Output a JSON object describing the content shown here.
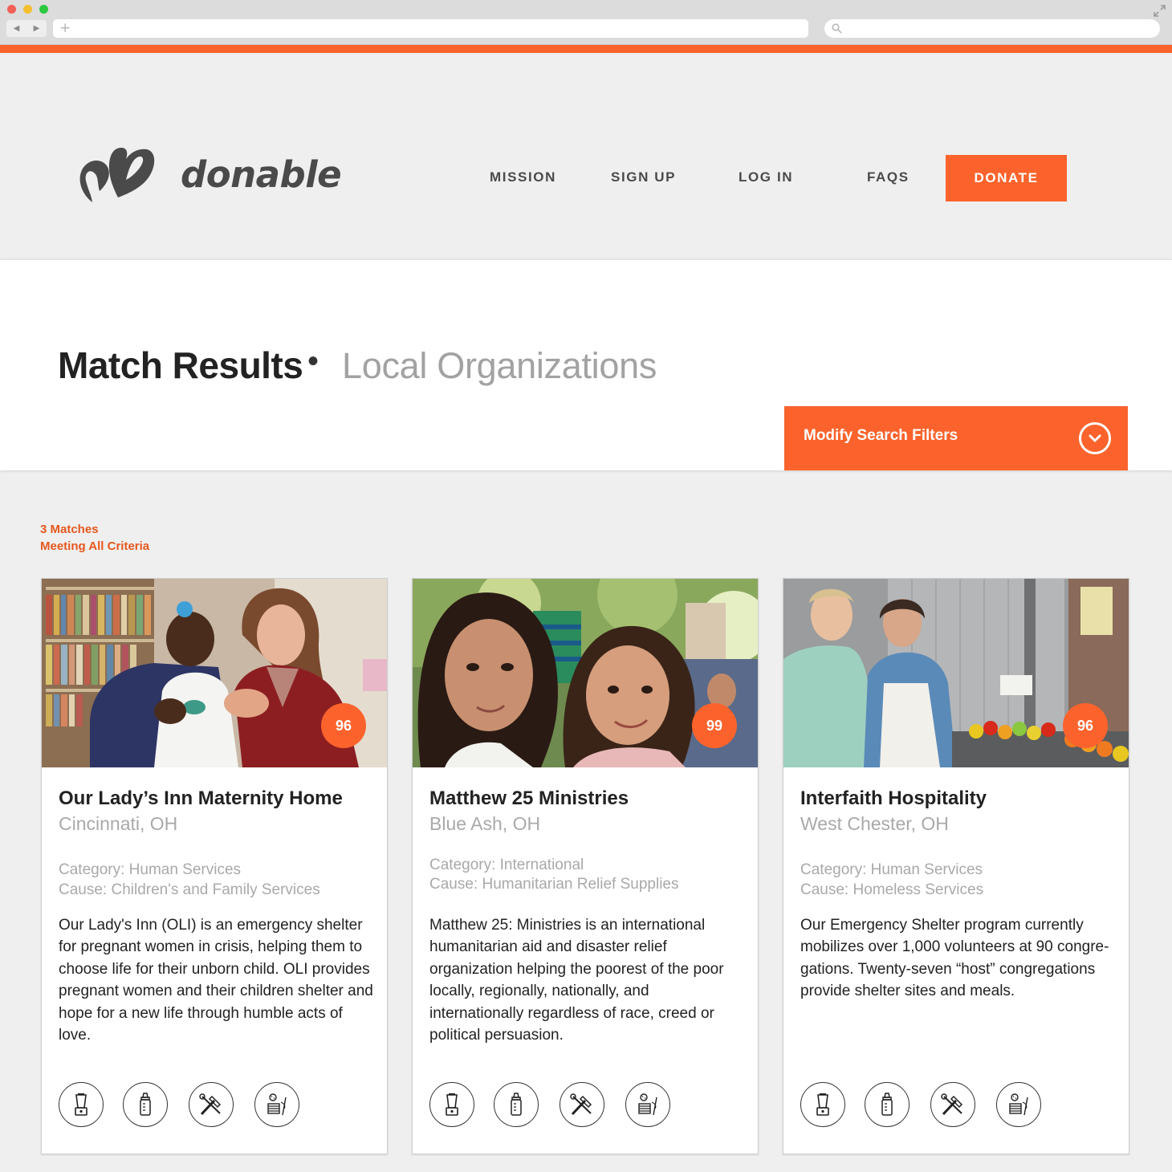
{
  "browser": {
    "back_glyph": "◀",
    "forward_glyph": "▶",
    "new_tab_glyph": "+"
  },
  "brand": {
    "name": "donable",
    "accent_color": "#fc632c"
  },
  "nav": {
    "mission": "MISSION",
    "signup": "SIGN UP",
    "login": "LOG IN",
    "faqs": "FAQS",
    "donate": "DONATE"
  },
  "page": {
    "title": "Match Results",
    "separator": "•",
    "subtitle": "Local Organizations",
    "filters_label": "Modify Search Filters",
    "matches_count": "3 Matches",
    "matches_note": "Meeting All Criteria"
  },
  "cards": [
    {
      "score": "96",
      "name": "Our Lady’s Inn Maternity Home",
      "location": "Cincinnati, OH",
      "category": "Category: Human Services",
      "cause": "Cause: Children's and Family Services",
      "description": "Our Lady's Inn (OLI) is an emergency shelter for pregnant women in crisis, helping them to choose life for their unborn child. OLI provides pregnant women and their children shelter and hope for a new life through humble acts of love.",
      "icons": [
        "blender-icon",
        "baby-bottle-icon",
        "tools-icon",
        "sewing-supplies-icon"
      ]
    },
    {
      "score": "99",
      "name": "Matthew 25 Ministries",
      "location": "Blue Ash, OH",
      "category": "Category: International",
      "cause": "Cause: Humanitarian Relief Supplies",
      "description": "Matthew 25: Ministries is an international humanitarian aid and disaster relief organization helping the poorest of the poor locally, regionally, nationally, and internationally regardless of race, creed or political persuasion.",
      "icons": [
        "blender-icon",
        "baby-bottle-icon",
        "tools-icon",
        "sewing-supplies-icon"
      ]
    },
    {
      "score": "96",
      "name": "Interfaith Hospitality",
      "location": "West Chester, OH",
      "category": "Category: Human Services",
      "cause": "Cause: Homeless Services",
      "description": "Our Emergency Shelter program currently mobilizes over 1,000 volunteers at 90 congre­gations. Twenty-seven “host” congregations provide shelter sites and meals.",
      "icons": [
        "blender-icon",
        "baby-bottle-icon",
        "tools-icon",
        "sewing-supplies-icon"
      ]
    }
  ]
}
